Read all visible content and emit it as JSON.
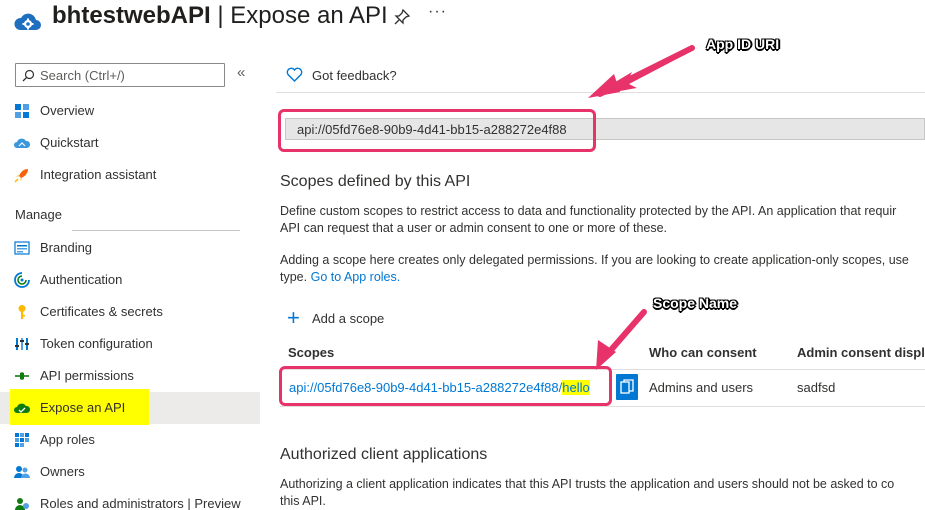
{
  "header": {
    "app_name": "bhtestwebAPI",
    "separator": " | ",
    "page_name": "Expose an API",
    "more": "···"
  },
  "sidebar": {
    "search_placeholder": "Search (Ctrl+/)",
    "collapse": "«",
    "top_items": [
      {
        "label": "Overview",
        "icon": "overview-grid-icon"
      },
      {
        "label": "Quickstart",
        "icon": "cloud-icon"
      },
      {
        "label": "Integration assistant",
        "icon": "rocket-icon"
      }
    ],
    "manage_label": "Manage",
    "manage_items": [
      {
        "label": "Branding",
        "icon": "branding-icon"
      },
      {
        "label": "Authentication",
        "icon": "authentication-icon"
      },
      {
        "label": "Certificates & secrets",
        "icon": "key-icon"
      },
      {
        "label": "Token configuration",
        "icon": "token-bars-icon"
      },
      {
        "label": "API permissions",
        "icon": "api-permissions-icon"
      },
      {
        "label": "Expose an API",
        "icon": "expose-cloud-icon",
        "active": true
      },
      {
        "label": "App roles",
        "icon": "app-roles-grid-icon"
      },
      {
        "label": "Owners",
        "icon": "owners-icon"
      },
      {
        "label": "Roles and administrators | Preview",
        "icon": "roles-admin-icon"
      }
    ]
  },
  "main": {
    "feedback_label": "Got feedback?",
    "app_id_uri": "api://05fd76e8-90b9-4d41-bb15-a288272e4f88",
    "scopes_heading": "Scopes defined by this API",
    "scopes_desc_1": "Define custom scopes to restrict access to data and functionality protected by the API. An application that requir",
    "scopes_desc_2": "API can request that a user or admin consent to one or more of these.",
    "adding_desc_1": "Adding a scope here creates only delegated permissions. If you are looking to create application-only scopes, use",
    "adding_desc_2": "type.",
    "adding_link": "Go to App roles.",
    "add_scope_label": "Add a scope",
    "table_headers": [
      "Scopes",
      "Who can consent",
      "Admin consent displa"
    ],
    "row": {
      "scope_prefix": "api://05fd76e8-90b9-4d41-bb15-a288272e4f88/",
      "scope_suffix": "hello",
      "who": "Admins and users",
      "admin_display": "sadfsd"
    },
    "auth_heading": "Authorized client applications",
    "auth_desc_1": "Authorizing a client application indicates that this API trusts the application and users should not be asked to co",
    "auth_desc_2": "this API."
  },
  "annotations": {
    "app_id_label": "App ID URI",
    "scope_name_label": "Scope Name",
    "color": "#e8336a"
  },
  "theme": {
    "accent": "#0078d4",
    "highlight": "#ffff00"
  }
}
